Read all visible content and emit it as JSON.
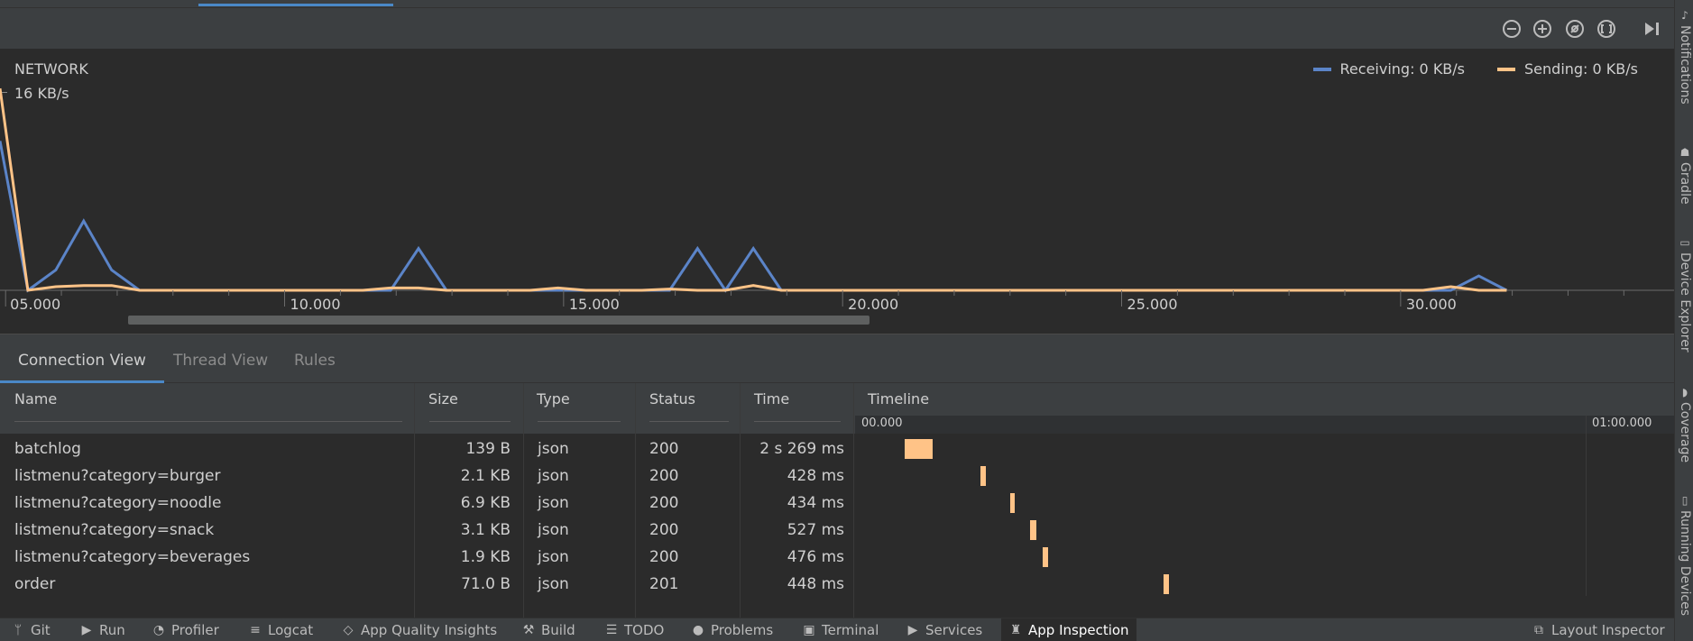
{
  "toolbar": {
    "buttons": [
      "zoom-out-icon",
      "zoom-in-icon",
      "reset-zoom-icon",
      "fit-icon",
      "jump-to-live-icon"
    ]
  },
  "chart_data": {
    "type": "line",
    "title": "NETWORK",
    "y_max_label": "16 KB/s",
    "legend_position": "top-right",
    "x_tick_labels": [
      "05.000",
      "10.000",
      "15.000",
      "20.000",
      "25.000",
      "30.000"
    ],
    "x_ticks": [
      5,
      10,
      15,
      20,
      25,
      30
    ],
    "xlim": [
      4.9,
      34.9
    ],
    "ylim": [
      0,
      16
    ],
    "series": [
      {
        "name": "Receiving: 0 KB/s",
        "color": "#5b84c8",
        "points": [
          [
            4.9,
            12.5
          ],
          [
            5.4,
            0
          ],
          [
            5.9,
            1.7
          ],
          [
            6.4,
            5.8
          ],
          [
            6.9,
            1.7
          ],
          [
            7.4,
            0
          ],
          [
            11.4,
            0
          ],
          [
            11.9,
            0
          ],
          [
            12.4,
            3.5
          ],
          [
            12.9,
            0
          ],
          [
            16.4,
            0
          ],
          [
            16.9,
            0
          ],
          [
            17.4,
            3.5
          ],
          [
            17.9,
            0
          ],
          [
            18.4,
            3.5
          ],
          [
            18.9,
            0
          ],
          [
            30.9,
            0
          ],
          [
            31.4,
            1.2
          ],
          [
            31.9,
            0
          ]
        ]
      },
      {
        "name": "Sending: 0 KB/s",
        "color": "#ffc387",
        "points": [
          [
            4.9,
            16.9
          ],
          [
            5.4,
            0
          ],
          [
            5.9,
            0.3
          ],
          [
            6.4,
            0.4
          ],
          [
            6.9,
            0.4
          ],
          [
            7.4,
            0
          ],
          [
            11.4,
            0
          ],
          [
            11.9,
            0.2
          ],
          [
            12.4,
            0.2
          ],
          [
            12.9,
            0
          ],
          [
            14.4,
            0
          ],
          [
            14.9,
            0.2
          ],
          [
            15.4,
            0
          ],
          [
            16.4,
            0
          ],
          [
            16.9,
            0.1
          ],
          [
            17.4,
            0
          ],
          [
            17.9,
            0
          ],
          [
            18.4,
            0.4
          ],
          [
            18.9,
            0
          ],
          [
            30.4,
            0
          ],
          [
            30.9,
            0.3
          ],
          [
            31.4,
            0
          ],
          [
            31.9,
            0
          ]
        ]
      }
    ]
  },
  "tabs": [
    "Connection View",
    "Thread View",
    "Rules"
  ],
  "table": {
    "headers": {
      "name": "Name",
      "size": "Size",
      "type": "Type",
      "status": "Status",
      "time": "Time",
      "timeline": "Timeline"
    },
    "timeline_start": "00.000",
    "timeline_end": "01:00.000",
    "rows": [
      {
        "name": "batchlog",
        "size": "139 B",
        "type": "json",
        "status": "200",
        "time": "2 s 269 ms",
        "bar_start_s": 3.6,
        "bar_duration_s": 2.3
      },
      {
        "name": "listmenu?category=burger",
        "size": "2.1 KB",
        "type": "json",
        "status": "200",
        "time": "428 ms",
        "bar_start_s": 9.9,
        "bar_duration_s": 0.43
      },
      {
        "name": "listmenu?category=noodle",
        "size": "6.9 KB",
        "type": "json",
        "status": "200",
        "time": "434 ms",
        "bar_start_s": 12.3,
        "bar_duration_s": 0.43
      },
      {
        "name": "listmenu?category=snack",
        "size": "3.1 KB",
        "type": "json",
        "status": "200",
        "time": "527 ms",
        "bar_start_s": 14.0,
        "bar_duration_s": 0.53
      },
      {
        "name": "listmenu?category=beverages",
        "size": "1.9 KB",
        "type": "json",
        "status": "200",
        "time": "476 ms",
        "bar_start_s": 15.0,
        "bar_duration_s": 0.48
      },
      {
        "name": "order",
        "size": "71.0 B",
        "type": "json",
        "status": "201",
        "time": "448 ms",
        "bar_start_s": 25.0,
        "bar_duration_s": 0.45
      }
    ]
  },
  "bottom_bar": {
    "items": [
      {
        "label": "Git",
        "icon": "git-branch-icon"
      },
      {
        "label": "Run",
        "icon": "play-icon"
      },
      {
        "label": "Profiler",
        "icon": "gauge-icon"
      },
      {
        "label": "Logcat",
        "icon": "logcat-icon"
      },
      {
        "label": "App Quality Insights",
        "icon": "diamond-icon"
      },
      {
        "label": "Build",
        "icon": "hammer-icon"
      },
      {
        "label": "TODO",
        "icon": "list-icon"
      },
      {
        "label": "Problems",
        "icon": "alert-icon"
      },
      {
        "label": "Terminal",
        "icon": "terminal-icon"
      },
      {
        "label": "Services",
        "icon": "services-icon"
      },
      {
        "label": "App Inspection",
        "icon": "inspector-icon"
      }
    ],
    "right_item": {
      "label": "Layout Inspector",
      "icon": "layout-inspector-icon"
    }
  },
  "right_bar": {
    "items": [
      {
        "label": "Notifications",
        "icon": "bell-icon"
      },
      {
        "label": "Gradle",
        "icon": "elephant-icon"
      },
      {
        "label": "Device Explorer",
        "icon": "device-icon"
      },
      {
        "label": "Coverage",
        "icon": "shield-icon"
      },
      {
        "label": "Running Devices",
        "icon": "phone-icon"
      }
    ]
  },
  "colors": {
    "receiving": "#5b84c8",
    "sending": "#ffc387",
    "accent": "#4a88c7"
  }
}
